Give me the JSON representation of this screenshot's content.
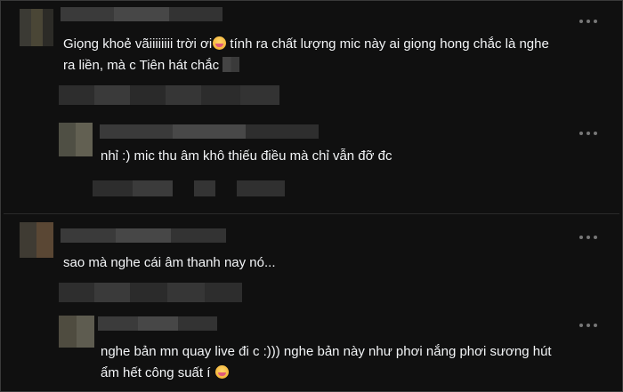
{
  "comments": [
    {
      "text_line1": "Giọng khoẻ vãiiiiiiii trời ơi",
      "text_line1b": " tính ra chất lượng mic này ai giọng hong chắc là nghe",
      "text_line2": "ra liền, mà c Tiên hát chắc"
    },
    {
      "text": "nhỉ :) mic thu âm khô thiếu điều mà chỉ vẫn đỡ đc"
    },
    {
      "text": "sao mà nghe cái âm thanh nay nó..."
    },
    {
      "text_line1": "nghe bản mn quay live đi c :))) nghe bản này như phơi nắng phơi sương hút",
      "text_line2": "ẩm hết công suất í"
    }
  ],
  "icons": {
    "more": "more-horizontal-icon",
    "emoji": "emoji-icon"
  },
  "colors": {
    "background": "#101010",
    "text": "#f3f5f7",
    "muted": "#777777"
  }
}
